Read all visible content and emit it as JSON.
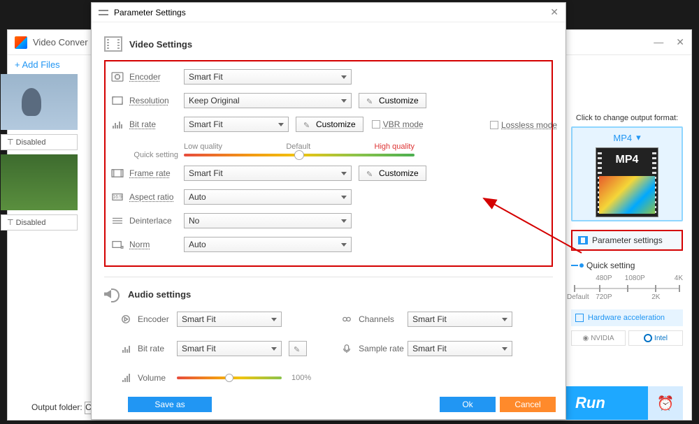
{
  "bgApp": {
    "title": "Video Conver",
    "addFiles": "+  Add Files",
    "disabled": "Disabled",
    "outputFolder": "Output folder:",
    "runLabel": "Run"
  },
  "sidebar": {
    "clickChange": "Click to change output format:",
    "formatName": "MP4",
    "paramSettings": "Parameter settings",
    "quickSetting": "Quick setting",
    "ticks": {
      "p480": "480P",
      "p720": "720P",
      "p1080": "1080P",
      "p2k": "2K",
      "p4k": "4K",
      "default": "Default"
    },
    "hwAccel": "Hardware acceleration",
    "nvidia": "NVIDIA",
    "intel": "Intel"
  },
  "modal": {
    "title": "Parameter Settings",
    "videoSection": "Video Settings",
    "audioSection": "Audio settings",
    "labels": {
      "encoder": "Encoder",
      "resolution": "Resolution",
      "bitrate": "Bit rate",
      "framerate": "Frame rate",
      "aspect": "Aspect ratio",
      "deinterlace": "Deinterlace",
      "norm": "Norm",
      "channels": "Channels",
      "samplerate": "Sample rate",
      "volume": "Volume",
      "quickSetting": "Quick setting"
    },
    "values": {
      "encoder": "Smart Fit",
      "resolution": "Keep Original",
      "bitrate": "Smart Fit",
      "framerate": "Smart Fit",
      "aspect": "Auto",
      "deinterlace": "No",
      "norm": "Auto",
      "aencoder": "Smart Fit",
      "abitrate": "Smart Fit",
      "channels": "Smart Fit",
      "samplerate": "Smart Fit",
      "volumePct": "100%"
    },
    "quality": {
      "low": "Low quality",
      "default": "Default",
      "high": "High quality"
    },
    "customize": "Customize",
    "vbrMode": "VBR mode",
    "lossless": "Lossless mode",
    "buttons": {
      "save": "Save as",
      "ok": "Ok",
      "cancel": "Cancel"
    }
  }
}
